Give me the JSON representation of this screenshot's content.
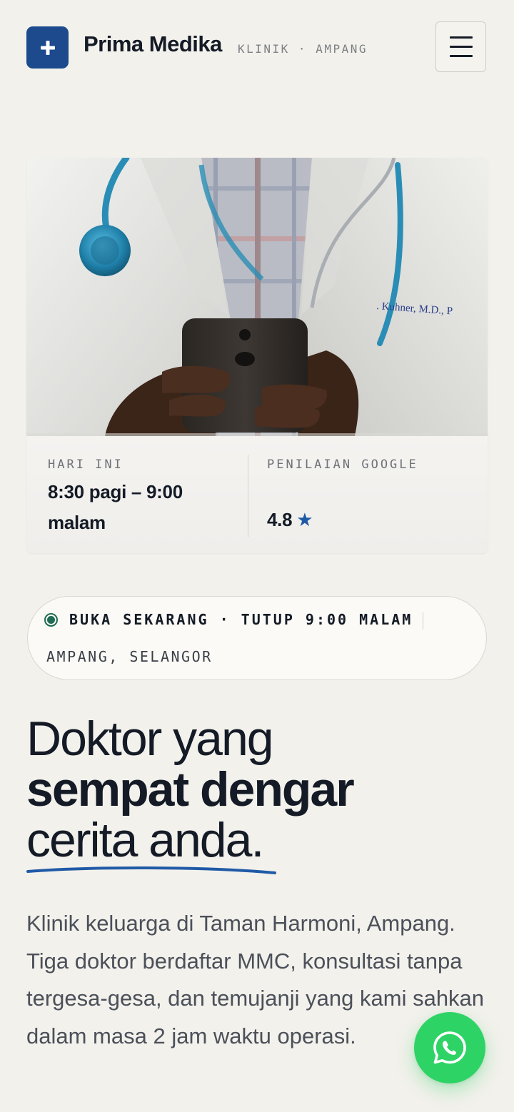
{
  "header": {
    "brand": "Prima Medika",
    "subtitle": "KLINIK · AMPANG"
  },
  "icons": {
    "logo": "plus-icon",
    "menu": "hamburger-menu-icon",
    "rating": "star-icon",
    "status": "open-status-dot-icon",
    "chat": "whatsapp-icon"
  },
  "hero": {
    "today_label": "HARI INI",
    "today_hours_line1": "8:30 pagi – 9:00",
    "today_hours_line2": "malam",
    "rating_label": "PENILAIAN GOOGLE",
    "rating_value": "4.8",
    "rating_star": "★"
  },
  "status": {
    "main": "BUKA SEKARANG · TUTUP 9:00 MALAM",
    "location": "AMPANG, SELANGOR"
  },
  "headline": {
    "line1": "Doktor yang",
    "line2": "sempat dengar",
    "line3": "cerita anda."
  },
  "intro": "Klinik keluarga di Taman Harmoni, Ampang. Tiga doktor berdaftar MMC, konsultasi tanpa tergesa-gesa, dan temujanji yang kami sahkan dalam masa 2 jam waktu operasi.",
  "colors": {
    "background": "#f3f1ec",
    "brand": "#1c4a8c",
    "accent_blue": "#1f5aa6",
    "open_green": "#1f6b53",
    "whatsapp": "#2ed366",
    "text": "#141b26"
  }
}
